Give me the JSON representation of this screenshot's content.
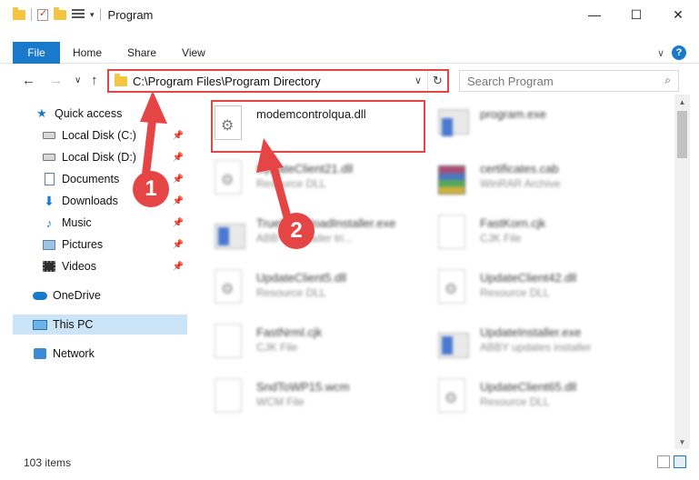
{
  "window": {
    "title": "Program",
    "controls": {
      "minimize": "—",
      "maximize": "☐",
      "close": "✕"
    }
  },
  "ribbon": {
    "file_tab": "File",
    "tabs": [
      "Home",
      "Share",
      "View"
    ],
    "help": "?"
  },
  "address": {
    "path": "C:\\Program Files\\Program Directory",
    "search_placeholder": "Search Program"
  },
  "sidebar": {
    "items": [
      {
        "label": "Quick access",
        "icon": "star-icon"
      },
      {
        "label": "Local Disk (C:)",
        "icon": "drive-icon"
      },
      {
        "label": "Local Disk (D:)",
        "icon": "drive-icon"
      },
      {
        "label": "Documents",
        "icon": "documents-icon"
      },
      {
        "label": "Downloads",
        "icon": "download-icon"
      },
      {
        "label": "Music",
        "icon": "music-icon"
      },
      {
        "label": "Pictures",
        "icon": "pictures-icon"
      },
      {
        "label": "Videos",
        "icon": "videos-icon"
      },
      {
        "label": "OneDrive",
        "icon": "cloud-icon"
      },
      {
        "label": "This PC",
        "icon": "computer-icon"
      },
      {
        "label": "Network",
        "icon": "network-icon"
      }
    ]
  },
  "files": [
    {
      "name": "modemcontrolqua.dll",
      "type": ""
    },
    {
      "name": "program.exe",
      "type": ""
    },
    {
      "name": "UpdateClient21.dll",
      "type": "Resource DLL"
    },
    {
      "name": "certificates.cab",
      "type": "WinRAR Archive"
    },
    {
      "name": "TrueDownloadInstaller.exe",
      "type": "ABBYY Reader tri..."
    },
    {
      "name": "FastKorn.cjk",
      "type": "CJK File"
    },
    {
      "name": "UpdateClient5.dll",
      "type": "Resource DLL"
    },
    {
      "name": "UpdateClient42.dll",
      "type": "Resource DLL"
    },
    {
      "name": "FastNrml.cjk",
      "type": "CJK File"
    },
    {
      "name": "UpdateInstaller.exe",
      "type": "ABBY updates installer"
    },
    {
      "name": "SndToWP15.wcm",
      "type": "WCM File"
    },
    {
      "name": "UpdateClient65.dll",
      "type": "Resource DLL"
    }
  ],
  "status": {
    "item_count": "103 items"
  },
  "annotations": {
    "step1": "1",
    "step2": "2",
    "color": "#e64545"
  }
}
